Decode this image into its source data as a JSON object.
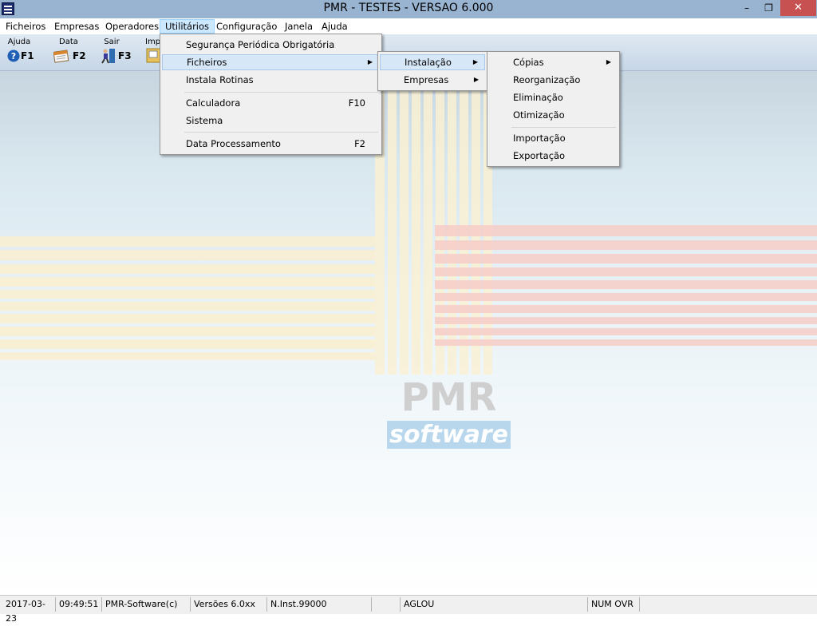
{
  "window": {
    "title": "PMR - TESTES - VERSAO 6.000",
    "minimize_glyph": "–",
    "restore_glyph": "❐",
    "close_glyph": "✕"
  },
  "menubar": {
    "items": [
      "Ficheiros",
      "Empresas",
      "Operadores",
      "Utilitários",
      "Configuração",
      "Janela",
      "Ajuda"
    ]
  },
  "toolbar": {
    "buttons": [
      {
        "label": "Ajuda",
        "key": "F1",
        "icon": "help-icon"
      },
      {
        "label": "Data",
        "key": "F2",
        "icon": "calendar-icon"
      },
      {
        "label": "Sair",
        "key": "F3",
        "icon": "exit-person-icon"
      },
      {
        "label": "Impr",
        "key": "",
        "icon": "printer-icon"
      }
    ]
  },
  "utilitarios_menu": {
    "items": [
      {
        "label": "Segurança Periódica Obrigatória",
        "shortcut": ""
      },
      {
        "label": "Ficheiros",
        "shortcut": "",
        "submenu": true
      },
      {
        "label": "Instala Rotinas",
        "shortcut": ""
      },
      {
        "label": "Calculadora",
        "shortcut": "F10"
      },
      {
        "label": "Sistema",
        "shortcut": ""
      },
      {
        "label": "Data Processamento",
        "shortcut": "F2"
      }
    ]
  },
  "ficheiros_submenu": {
    "items": [
      {
        "label": "Instalação",
        "submenu": true
      },
      {
        "label": "Empresas",
        "submenu": true
      }
    ]
  },
  "instalacao_submenu": {
    "items": [
      {
        "label": "Cópias",
        "submenu": true
      },
      {
        "label": "Reorganização"
      },
      {
        "label": "Eliminação"
      },
      {
        "label": "Otimização"
      },
      {
        "label": "Importação"
      },
      {
        "label": "Exportação"
      }
    ]
  },
  "logo": {
    "top": "PMR",
    "bottom": "software"
  },
  "statusbar": {
    "date": "2017-03-23",
    "time": "09:49:51",
    "company": "PMR-Software(c)",
    "version": "Versões 6.0xx",
    "install": "N.Inst.99000",
    "empty": "",
    "user": "AGLOU",
    "keys": "NUM OVR"
  },
  "colors": {
    "titlebar": "#99b4d1",
    "close_button": "#c75050",
    "menu_highlight": "#d6e7f7",
    "logo_blue": "#b9d7ec"
  }
}
